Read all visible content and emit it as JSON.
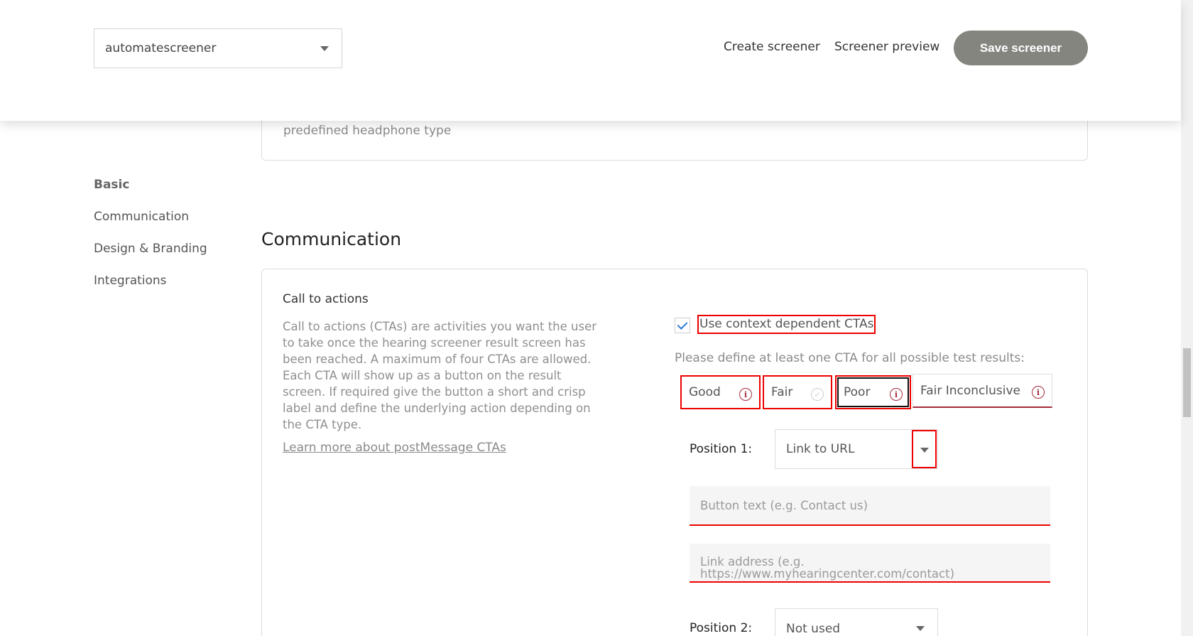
{
  "header": {
    "screener_name": "automatescreener",
    "create_link": "Create screener",
    "preview_link": "Screener preview",
    "save_button": "Save screener"
  },
  "top_card": {
    "text": "predefined headphone type"
  },
  "sidebar": {
    "items": [
      {
        "label": "Basic"
      },
      {
        "label": "Communication"
      },
      {
        "label": "Design & Branding"
      },
      {
        "label": "Integrations"
      }
    ]
  },
  "section": {
    "title": "Communication"
  },
  "cta": {
    "heading": "Call to actions",
    "description": "Call to actions (CTAs) are activities you want the user to take once the hearing screener result screen has been reached. A maximum of four CTAs are allowed. Each CTA will show up as a button on the result screen. If required give the button a short and crisp label and define the underlying action depending on the CTA type.",
    "learn_more": "Learn more about postMessage CTAs",
    "checkbox_label": "Use context dependent CTAs",
    "checkbox_checked": true,
    "define_text": "Please define at least one CTA for all possible test results:",
    "tabs": [
      {
        "label": "Good",
        "icon": "info-icon"
      },
      {
        "label": "Fair",
        "icon": "check-icon"
      },
      {
        "label": "Poor",
        "icon": "info-icon"
      },
      {
        "label": "Fair Inconclusive",
        "icon": "info-icon"
      }
    ],
    "position1": {
      "label": "Position 1:",
      "value": "Link to URL",
      "button_text_placeholder": "Button text (e.g. Contact us)",
      "link_placeholder_line1": "Link address (e.g.",
      "link_placeholder_line2": "https://www.myhearingcenter.com/contact)"
    },
    "position2": {
      "label": "Position 2:",
      "value": "Not used"
    }
  },
  "colors": {
    "error_red": "#e00000",
    "save_button_bg": "#858580",
    "info_icon": "#a52a3a"
  }
}
